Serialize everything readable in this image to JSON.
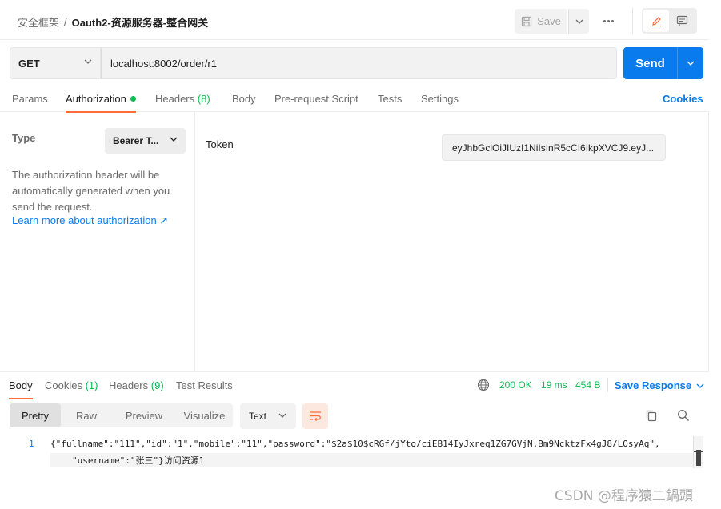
{
  "breadcrumb": {
    "parent": "安全框架",
    "separator": "/",
    "current": "Oauth2-资源服务器-整合网关"
  },
  "toolbar": {
    "save_label": "Save"
  },
  "request": {
    "method": "GET",
    "url": "localhost:8002/order/r1",
    "send_label": "Send"
  },
  "tabs": [
    {
      "label": "Params"
    },
    {
      "label": "Authorization"
    },
    {
      "label": "Headers",
      "count": "(8)"
    },
    {
      "label": "Body"
    },
    {
      "label": "Pre-request Script"
    },
    {
      "label": "Tests"
    },
    {
      "label": "Settings"
    }
  ],
  "cookies_label": "Cookies",
  "auth": {
    "type_label": "Type",
    "type_value": "Bearer T...",
    "description": "The authorization header will be automatically generated when you send the request.",
    "learn_more": "Learn more about authorization ↗",
    "token_label": "Token",
    "token_value": "eyJhbGciOiJIUzI1NiIsInR5cCI6IkpXVCJ9.eyJ..."
  },
  "response": {
    "tabs": [
      {
        "label": "Body"
      },
      {
        "label": "Cookies",
        "count": "(1)"
      },
      {
        "label": "Headers",
        "count": "(9)"
      },
      {
        "label": "Test Results"
      }
    ],
    "status": "200 OK",
    "time": "19 ms",
    "size": "454 B",
    "save_label": "Save Response",
    "formats": [
      "Pretty",
      "Raw",
      "Preview",
      "Visualize"
    ],
    "format_type": "Text",
    "line_number": "1",
    "line1": "{\"fullname\":\"111\",\"id\":\"1\",\"mobile\":\"11\",\"password\":\"$2a$10$cRGf/jYto/ciEB14IyJxreq1ZG7GVjN.Bm9NcktzFx4gJ8/LOsyAq\",",
    "line2_prefix": "\"username\":\"",
    "line2_name": "张三",
    "line2_suffix": "\"}",
    "line2_tail": "访问资源1"
  },
  "watermark": "CSDN @程序猿二鍋頭",
  "colors": {
    "accent": "#ff6c37",
    "primary": "#097bed",
    "success": "#0cbb52"
  }
}
